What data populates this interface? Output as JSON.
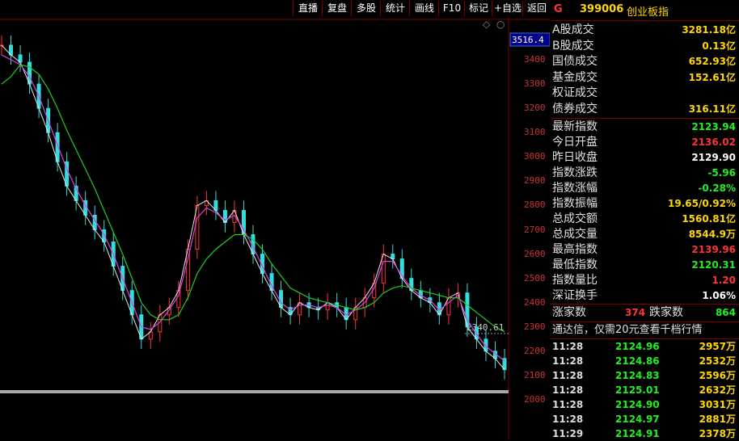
{
  "toolbar": {
    "buttons": [
      "直播",
      "复盘",
      "多股",
      "统计",
      "画线",
      "F10",
      "标记",
      "+自选",
      "返回"
    ]
  },
  "chart": {
    "current_high_label": "3516.4",
    "y_ticks": [
      "3400",
      "3300",
      "3200",
      "3100",
      "3000",
      "2900",
      "2800",
      "2700",
      "2600",
      "2500",
      "2400",
      "2300",
      "2200",
      "2100",
      "2000"
    ],
    "annotation": "2340.61"
  },
  "chart_data": {
    "type": "line",
    "ylim": [
      1950,
      3516.4
    ],
    "series": [
      {
        "values": [
          3460,
          3420,
          3390,
          3300,
          3200,
          3100,
          2980,
          2880,
          2820,
          2760,
          2700,
          2650,
          2550,
          2450,
          2350,
          2250,
          2280,
          2350,
          2380,
          2450,
          2620,
          2800,
          2820,
          2780,
          2730,
          2780,
          2680,
          2600,
          2520,
          2450,
          2380,
          2350,
          2400,
          2380,
          2370,
          2400,
          2380,
          2330,
          2380,
          2420,
          2480,
          2600,
          2580,
          2500,
          2450,
          2420,
          2400,
          2350,
          2420,
          2440,
          2300,
          2250,
          2200,
          2170,
          2124
        ]
      },
      {
        "values": [
          3420,
          3400,
          3380,
          3330,
          3250,
          3150,
          3050,
          2950,
          2870,
          2800,
          2740,
          2680,
          2600,
          2500,
          2400,
          2300,
          2290,
          2320,
          2370,
          2430,
          2580,
          2750,
          2790,
          2770,
          2740,
          2760,
          2700,
          2630,
          2550,
          2470,
          2400,
          2370,
          2390,
          2390,
          2380,
          2390,
          2380,
          2350,
          2370,
          2400,
          2460,
          2570,
          2570,
          2510,
          2460,
          2430,
          2410,
          2370,
          2400,
          2430,
          2330,
          2270,
          2220,
          2190,
          2160
        ]
      },
      {
        "values": [
          3300,
          3330,
          3380,
          3370,
          3340,
          3280,
          3200,
          3110,
          3030,
          2950,
          2870,
          2780,
          2690,
          2600,
          2500,
          2400,
          2350,
          2330,
          2330,
          2350,
          2420,
          2520,
          2580,
          2620,
          2650,
          2680,
          2680,
          2660,
          2620,
          2560,
          2510,
          2460,
          2440,
          2420,
          2410,
          2400,
          2390,
          2380,
          2370,
          2380,
          2400,
          2440,
          2460,
          2470,
          2460,
          2450,
          2440,
          2430,
          2420,
          2420,
          2390,
          2360,
          2330,
          2300,
          2280
        ]
      }
    ],
    "grid": false
  },
  "panel": {
    "g": "G",
    "code": "399006",
    "name": "创业板指",
    "trade_rows": [
      {
        "k": "A股成交",
        "v": "3281.18亿"
      },
      {
        "k": "B股成交",
        "v": "0.13亿"
      },
      {
        "k": "国债成交",
        "v": "652.93亿"
      },
      {
        "k": "基金成交",
        "v": "152.61亿"
      },
      {
        "k": "权证成交",
        "v": ""
      },
      {
        "k": "债券成交",
        "v": "316.11亿"
      }
    ],
    "index_rows": [
      {
        "k": "最新指数",
        "v": "2123.94",
        "c": "#2e2"
      },
      {
        "k": "今日开盘",
        "v": "2136.02",
        "c": "#f33"
      },
      {
        "k": "昨日收盘",
        "v": "2129.90",
        "c": "#fff"
      },
      {
        "k": "指数涨跌",
        "v": "-5.96",
        "c": "#2e2"
      },
      {
        "k": "指数涨幅",
        "v": "-0.28%",
        "c": "#2e2"
      },
      {
        "k": "指数振幅",
        "v": "19.65/0.92%",
        "c": "#ffd700"
      },
      {
        "k": "总成交额",
        "v": "1560.81亿",
        "c": "#ffd700"
      },
      {
        "k": "总成交量",
        "v": "8544.9万",
        "c": "#ffd700"
      },
      {
        "k": "最高指数",
        "v": "2139.96",
        "c": "#f33"
      },
      {
        "k": "最低指数",
        "v": "2120.31",
        "c": "#2e2"
      },
      {
        "k": "指数量比",
        "v": "1.20",
        "c": "#f33"
      },
      {
        "k": "深证换手",
        "v": "1.06%",
        "c": "#fff"
      }
    ],
    "up_label": "涨家数",
    "up_count": "374",
    "down_label": "跌家数",
    "down_count": "864",
    "promo": "通达信，仅需20元查看千档行情",
    "ticks": [
      {
        "t": "11:28",
        "p": "2124.96",
        "v": "2957万"
      },
      {
        "t": "11:28",
        "p": "2124.86",
        "v": "2532万"
      },
      {
        "t": "11:28",
        "p": "2124.83",
        "v": "2596万"
      },
      {
        "t": "11:28",
        "p": "2125.01",
        "v": "2632万"
      },
      {
        "t": "11:28",
        "p": "2124.90",
        "v": "3031万"
      },
      {
        "t": "11:28",
        "p": "2124.97",
        "v": "2881万"
      },
      {
        "t": "11:29",
        "p": "2124.91",
        "v": "2378万"
      }
    ]
  }
}
